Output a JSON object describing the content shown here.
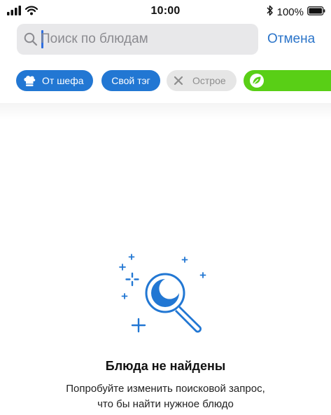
{
  "status_bar": {
    "time": "10:00",
    "battery_percent": "100%",
    "icons": [
      "signal-icon",
      "wifi-icon",
      "bluetooth-icon",
      "battery-icon"
    ]
  },
  "search": {
    "placeholder": "Поиск по блюдам",
    "value": "",
    "cancel_label": "Отмена"
  },
  "filters": [
    {
      "label": "От шефа",
      "icon": "chef-hat-icon",
      "state": "selected"
    },
    {
      "label": "Свой тэг",
      "state": "selected"
    },
    {
      "label": "Острое",
      "icon": "close-icon",
      "state": "inactive"
    },
    {
      "label": "",
      "icon": "leaf-icon",
      "state": "selected"
    }
  ],
  "empty_state": {
    "icon": "magnifier-moon-icon",
    "title": "Блюда не найдены",
    "subtitle_line1": "Попробуйте изменить поисковой запрос,",
    "subtitle_line2": "что бы найти нужное блюдо"
  },
  "colors": {
    "accent_blue": "#2277d3",
    "link_blue": "#2b74c9",
    "chip_inactive": "#e6e6e6",
    "chip_green": "#59cf16",
    "search_bg": "#e8e8ea"
  }
}
